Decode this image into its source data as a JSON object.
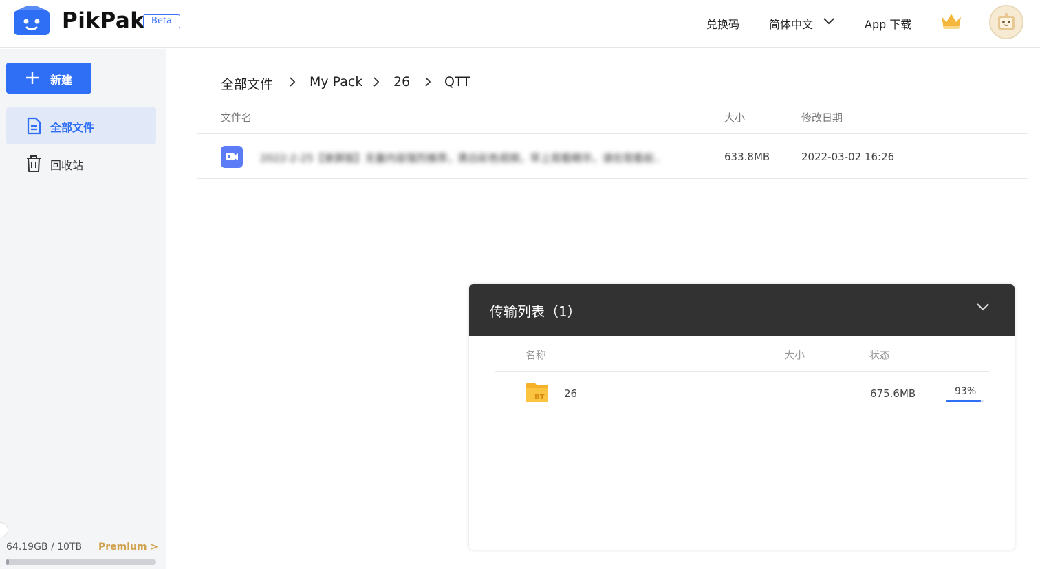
{
  "header": {
    "brand": "PikPak",
    "beta": "Beta",
    "redeem_code": "兑换码",
    "language": "简体中文",
    "app_download": "App 下载",
    "crown_icon": "crown-icon",
    "avatar_icon": "avatar-icon"
  },
  "sidebar": {
    "new_button": "新建",
    "items": [
      {
        "label": "全部文件",
        "icon": "document-icon",
        "active": true
      },
      {
        "label": "回收站",
        "icon": "trash-icon",
        "active": false
      }
    ],
    "storage": {
      "used": "64.19GB / 10TB",
      "premium": "Premium >",
      "fraction": 0.0063
    }
  },
  "breadcrumb": [
    "全部文件",
    "My Pack",
    "26",
    "QTT"
  ],
  "table": {
    "columns": {
      "name": "文件名",
      "size": "大小",
      "modified": "修改日期"
    },
    "rows": [
      {
        "icon": "video-icon",
        "name": "2022-2-25【录屏版】无量内容强烈推荐，黑白彩色视频，早上观看精华，请在观看前..",
        "size": "633.8MB",
        "modified": "2022-03-02 16:26"
      }
    ]
  },
  "transfer": {
    "title": "传输列表（1）",
    "columns": {
      "name": "名称",
      "size": "大小",
      "status": "状态"
    },
    "rows": [
      {
        "icon": "bt-folder-icon",
        "name": "26",
        "size": "675.6MB",
        "progress_label": "93%",
        "progress": 0.93
      }
    ]
  },
  "colors": {
    "accent": "#2f6ff5",
    "premium": "#d1a24e",
    "panel_header": "#323232"
  }
}
